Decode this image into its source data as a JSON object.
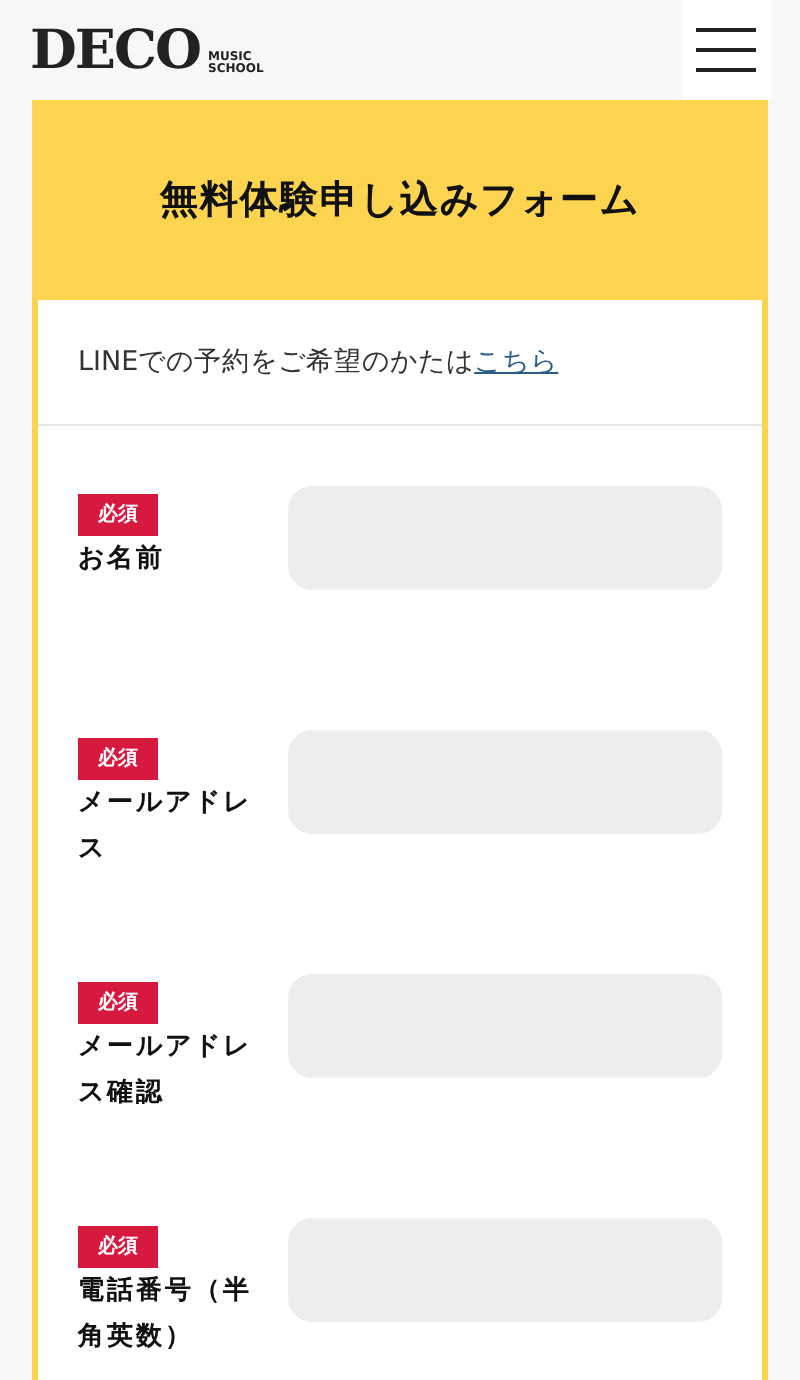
{
  "header": {
    "logo": {
      "main": "DECO",
      "sub_1": "MUSIC",
      "sub_2": "SCHOOL"
    }
  },
  "form": {
    "title": "無料体験申し込みフォーム",
    "line_note": {
      "text": "LINEでの予約をご希望のかたは",
      "link": "こちら"
    },
    "fields": [
      {
        "badge": "必須",
        "label": "お名前",
        "required": true
      },
      {
        "badge": "必須",
        "label": "メールアドレス",
        "required": true
      },
      {
        "badge": "必須",
        "label": "メールアドレス確認",
        "required": true
      },
      {
        "badge": "必須",
        "label": "電話番号（半角英数）",
        "required": true
      }
    ]
  }
}
